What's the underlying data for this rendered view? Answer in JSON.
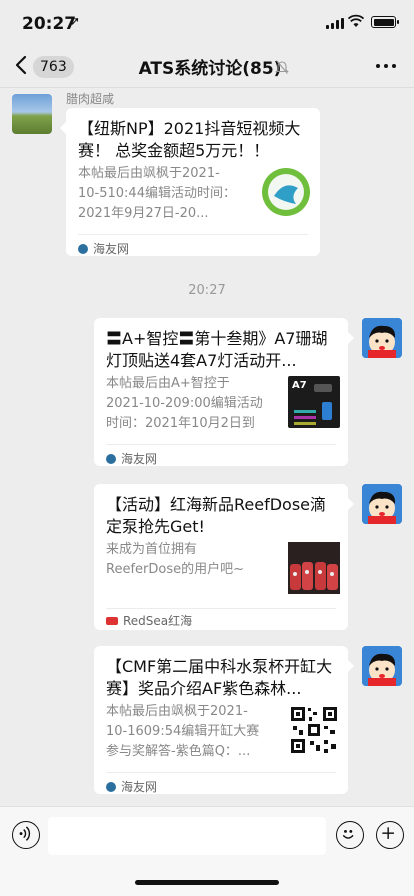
{
  "status_bar": {
    "time": "20:27",
    "location_arrow": "➚"
  },
  "nav": {
    "back_icon": "chevron-left",
    "unread_count": "763",
    "title": "ATS系统讨论(85)",
    "mute_icon": "bell-slash",
    "more_icon": "ellipsis"
  },
  "messages": [
    {
      "sender": "腊肉超咸",
      "title": "【纽斯NP】2021抖音短视频大赛！ 总奖金额超5万元！！",
      "desc": "本帖最后由飒枫于2021-10-510:44编辑活动时间：2021年9月27日-20...",
      "source": "海友网"
    },
    {
      "title": "〓A+智控〓第十叁期》A7珊瑚灯顶贴送4套A7灯活动开...",
      "desc": "本帖最后由A+智控于2021-10-209:00编辑活动时间：2021年10月2日到1...",
      "source": "海友网",
      "thumb_label": "A7"
    },
    {
      "title": "【活动】红海新品ReefDose滴定泵抢先Get!",
      "desc": "来成为首位拥有ReeferDose的用户吧~",
      "source": "RedSea红海"
    },
    {
      "title": "【CMF第二届中科水泵杯开缸大赛】奖品介绍AF紫色森林...",
      "desc": "本帖最后由飒枫于2021-10-1609:54编辑开缸大赛参与奖解答-紫色篇Q：...",
      "source": "海友网"
    }
  ],
  "timestamp": "20:27",
  "input_bar": {
    "voice_icon": "voice",
    "emoji_icon": "smiley",
    "plus_icon": "plus"
  }
}
